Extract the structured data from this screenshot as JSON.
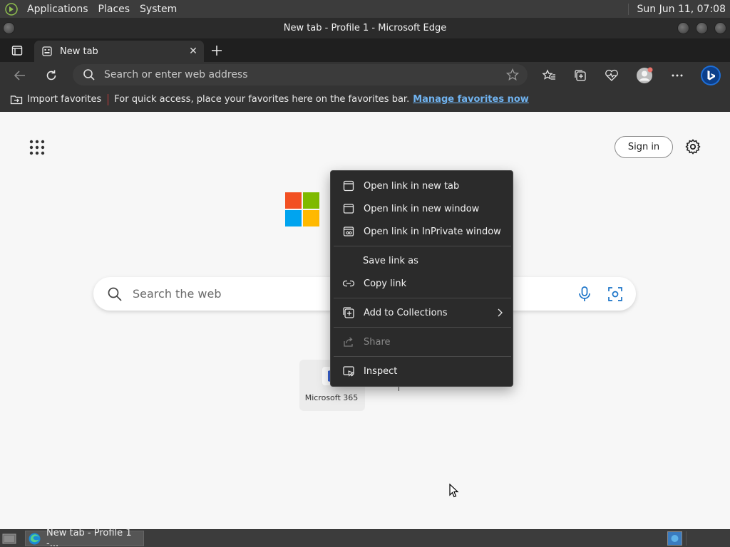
{
  "system_panel": {
    "menus": [
      "Applications",
      "Places",
      "System"
    ],
    "clock": "Sun Jun 11, 07:08"
  },
  "window": {
    "title": "New tab - Profile 1 - Microsoft Edge"
  },
  "tabs": [
    {
      "label": "New tab",
      "icon": "page-icon",
      "active": true
    }
  ],
  "toolbar": {
    "address_placeholder": "Search or enter web address",
    "icons": [
      "back-icon",
      "refresh-icon",
      "search-icon",
      "star-add-icon",
      "favorites-icon",
      "collections-icon",
      "browser-essentials-icon",
      "profile-avatar",
      "more-icon",
      "copilot-icon"
    ]
  },
  "favorites_bar": {
    "import_label": "Import favorites",
    "message": "For quick access, place your favorites here on the favorites bar.",
    "manage_link": "Manage favorites now"
  },
  "page": {
    "signin_label": "Sign in",
    "search_placeholder": "Search the web",
    "quick_links": [
      {
        "name": "Microsoft 365"
      }
    ]
  },
  "context_menu": {
    "items": [
      {
        "label": "Open link in new tab",
        "icon": "new-tab-icon",
        "enabled": true
      },
      {
        "label": "Open link in new window",
        "icon": "new-window-icon",
        "enabled": true
      },
      {
        "label": "Open link in InPrivate window",
        "icon": "inprivate-window-icon",
        "enabled": true
      },
      {
        "label": "Save link as",
        "icon": "",
        "enabled": true
      },
      {
        "label": "Copy link",
        "icon": "link-icon",
        "enabled": true
      },
      {
        "label": "Add to Collections",
        "icon": "collections-icon",
        "enabled": true,
        "submenu": true
      },
      {
        "label": "Share",
        "icon": "share-icon",
        "enabled": false
      },
      {
        "label": "Inspect",
        "icon": "inspect-icon",
        "enabled": true
      }
    ]
  },
  "taskbar": {
    "task_label": "New tab - Profile 1 -..."
  },
  "colors": {
    "panel": "#3c3c3c",
    "titlebar": "#2b2b2b",
    "tabstrip": "#1f1f1f",
    "toolbar": "#333333",
    "page_bg": "#f7f7f7",
    "link": "#70b3f0",
    "ms_red": "#f25022",
    "ms_green": "#7fba00",
    "ms_blue": "#00a4ef",
    "ms_yellow": "#ffb900"
  }
}
